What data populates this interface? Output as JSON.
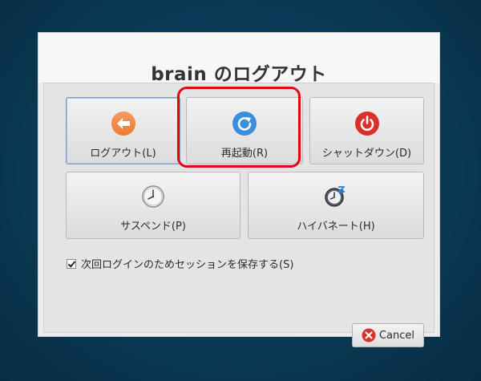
{
  "dialog": {
    "title": "brain のログアウト",
    "buttons": {
      "logout": {
        "label": "ログアウト(L)",
        "icon": "arrow-left-icon"
      },
      "restart": {
        "label": "再起動(R)",
        "icon": "restart-icon"
      },
      "shutdown": {
        "label": "シャットダウン(D)",
        "icon": "power-icon"
      },
      "suspend": {
        "label": "サスペンド(P)",
        "icon": "clock-icon"
      },
      "hibernate": {
        "label": "ハイバネート(H)",
        "icon": "hibernate-clock-icon"
      }
    },
    "save_session": {
      "label": "次回ログインのためセッションを保存する(S)",
      "checked": true
    },
    "cancel": {
      "label": "Cancel",
      "icon": "cancel-icon"
    }
  },
  "colors": {
    "logout": "#f07a30",
    "restart": "#3a8fdc",
    "shutdown": "#d9302a",
    "highlight": "#e30613"
  }
}
